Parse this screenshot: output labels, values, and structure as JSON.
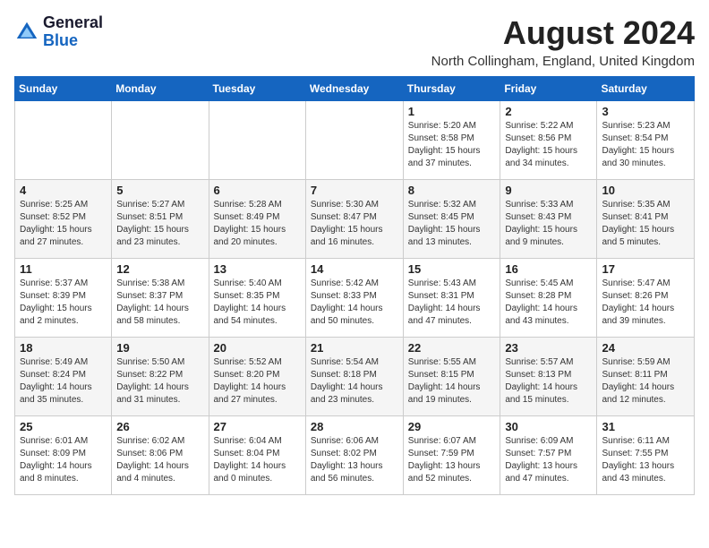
{
  "header": {
    "logo_line1": "General",
    "logo_line2": "Blue",
    "month_year": "August 2024",
    "location": "North Collingham, England, United Kingdom"
  },
  "weekdays": [
    "Sunday",
    "Monday",
    "Tuesday",
    "Wednesday",
    "Thursday",
    "Friday",
    "Saturday"
  ],
  "weeks": [
    [
      {
        "day": "",
        "sunrise": "",
        "sunset": "",
        "daylight": ""
      },
      {
        "day": "",
        "sunrise": "",
        "sunset": "",
        "daylight": ""
      },
      {
        "day": "",
        "sunrise": "",
        "sunset": "",
        "daylight": ""
      },
      {
        "day": "",
        "sunrise": "",
        "sunset": "",
        "daylight": ""
      },
      {
        "day": "1",
        "sunrise": "Sunrise: 5:20 AM",
        "sunset": "Sunset: 8:58 PM",
        "daylight": "Daylight: 15 hours and 37 minutes."
      },
      {
        "day": "2",
        "sunrise": "Sunrise: 5:22 AM",
        "sunset": "Sunset: 8:56 PM",
        "daylight": "Daylight: 15 hours and 34 minutes."
      },
      {
        "day": "3",
        "sunrise": "Sunrise: 5:23 AM",
        "sunset": "Sunset: 8:54 PM",
        "daylight": "Daylight: 15 hours and 30 minutes."
      }
    ],
    [
      {
        "day": "4",
        "sunrise": "Sunrise: 5:25 AM",
        "sunset": "Sunset: 8:52 PM",
        "daylight": "Daylight: 15 hours and 27 minutes."
      },
      {
        "day": "5",
        "sunrise": "Sunrise: 5:27 AM",
        "sunset": "Sunset: 8:51 PM",
        "daylight": "Daylight: 15 hours and 23 minutes."
      },
      {
        "day": "6",
        "sunrise": "Sunrise: 5:28 AM",
        "sunset": "Sunset: 8:49 PM",
        "daylight": "Daylight: 15 hours and 20 minutes."
      },
      {
        "day": "7",
        "sunrise": "Sunrise: 5:30 AM",
        "sunset": "Sunset: 8:47 PM",
        "daylight": "Daylight: 15 hours and 16 minutes."
      },
      {
        "day": "8",
        "sunrise": "Sunrise: 5:32 AM",
        "sunset": "Sunset: 8:45 PM",
        "daylight": "Daylight: 15 hours and 13 minutes."
      },
      {
        "day": "9",
        "sunrise": "Sunrise: 5:33 AM",
        "sunset": "Sunset: 8:43 PM",
        "daylight": "Daylight: 15 hours and 9 minutes."
      },
      {
        "day": "10",
        "sunrise": "Sunrise: 5:35 AM",
        "sunset": "Sunset: 8:41 PM",
        "daylight": "Daylight: 15 hours and 5 minutes."
      }
    ],
    [
      {
        "day": "11",
        "sunrise": "Sunrise: 5:37 AM",
        "sunset": "Sunset: 8:39 PM",
        "daylight": "Daylight: 15 hours and 2 minutes."
      },
      {
        "day": "12",
        "sunrise": "Sunrise: 5:38 AM",
        "sunset": "Sunset: 8:37 PM",
        "daylight": "Daylight: 14 hours and 58 minutes."
      },
      {
        "day": "13",
        "sunrise": "Sunrise: 5:40 AM",
        "sunset": "Sunset: 8:35 PM",
        "daylight": "Daylight: 14 hours and 54 minutes."
      },
      {
        "day": "14",
        "sunrise": "Sunrise: 5:42 AM",
        "sunset": "Sunset: 8:33 PM",
        "daylight": "Daylight: 14 hours and 50 minutes."
      },
      {
        "day": "15",
        "sunrise": "Sunrise: 5:43 AM",
        "sunset": "Sunset: 8:31 PM",
        "daylight": "Daylight: 14 hours and 47 minutes."
      },
      {
        "day": "16",
        "sunrise": "Sunrise: 5:45 AM",
        "sunset": "Sunset: 8:28 PM",
        "daylight": "Daylight: 14 hours and 43 minutes."
      },
      {
        "day": "17",
        "sunrise": "Sunrise: 5:47 AM",
        "sunset": "Sunset: 8:26 PM",
        "daylight": "Daylight: 14 hours and 39 minutes."
      }
    ],
    [
      {
        "day": "18",
        "sunrise": "Sunrise: 5:49 AM",
        "sunset": "Sunset: 8:24 PM",
        "daylight": "Daylight: 14 hours and 35 minutes."
      },
      {
        "day": "19",
        "sunrise": "Sunrise: 5:50 AM",
        "sunset": "Sunset: 8:22 PM",
        "daylight": "Daylight: 14 hours and 31 minutes."
      },
      {
        "day": "20",
        "sunrise": "Sunrise: 5:52 AM",
        "sunset": "Sunset: 8:20 PM",
        "daylight": "Daylight: 14 hours and 27 minutes."
      },
      {
        "day": "21",
        "sunrise": "Sunrise: 5:54 AM",
        "sunset": "Sunset: 8:18 PM",
        "daylight": "Daylight: 14 hours and 23 minutes."
      },
      {
        "day": "22",
        "sunrise": "Sunrise: 5:55 AM",
        "sunset": "Sunset: 8:15 PM",
        "daylight": "Daylight: 14 hours and 19 minutes."
      },
      {
        "day": "23",
        "sunrise": "Sunrise: 5:57 AM",
        "sunset": "Sunset: 8:13 PM",
        "daylight": "Daylight: 14 hours and 15 minutes."
      },
      {
        "day": "24",
        "sunrise": "Sunrise: 5:59 AM",
        "sunset": "Sunset: 8:11 PM",
        "daylight": "Daylight: 14 hours and 12 minutes."
      }
    ],
    [
      {
        "day": "25",
        "sunrise": "Sunrise: 6:01 AM",
        "sunset": "Sunset: 8:09 PM",
        "daylight": "Daylight: 14 hours and 8 minutes."
      },
      {
        "day": "26",
        "sunrise": "Sunrise: 6:02 AM",
        "sunset": "Sunset: 8:06 PM",
        "daylight": "Daylight: 14 hours and 4 minutes."
      },
      {
        "day": "27",
        "sunrise": "Sunrise: 6:04 AM",
        "sunset": "Sunset: 8:04 PM",
        "daylight": "Daylight: 14 hours and 0 minutes."
      },
      {
        "day": "28",
        "sunrise": "Sunrise: 6:06 AM",
        "sunset": "Sunset: 8:02 PM",
        "daylight": "Daylight: 13 hours and 56 minutes."
      },
      {
        "day": "29",
        "sunrise": "Sunrise: 6:07 AM",
        "sunset": "Sunset: 7:59 PM",
        "daylight": "Daylight: 13 hours and 52 minutes."
      },
      {
        "day": "30",
        "sunrise": "Sunrise: 6:09 AM",
        "sunset": "Sunset: 7:57 PM",
        "daylight": "Daylight: 13 hours and 47 minutes."
      },
      {
        "day": "31",
        "sunrise": "Sunrise: 6:11 AM",
        "sunset": "Sunset: 7:55 PM",
        "daylight": "Daylight: 13 hours and 43 minutes."
      }
    ]
  ]
}
